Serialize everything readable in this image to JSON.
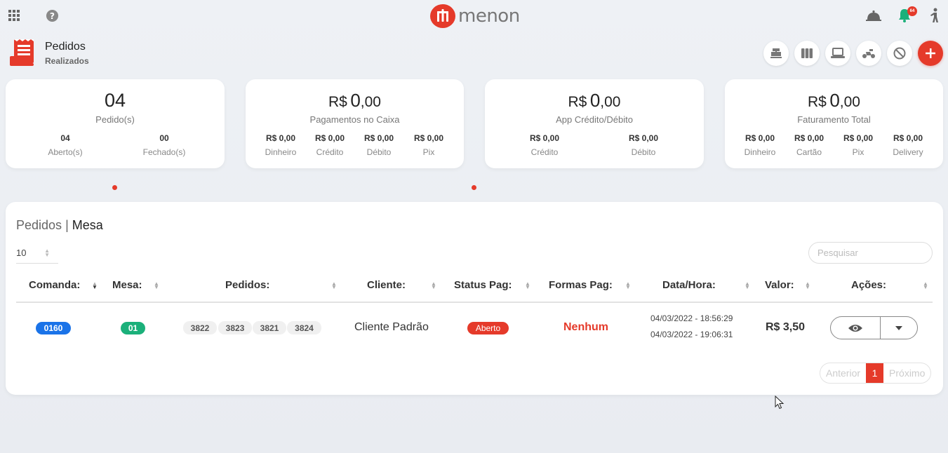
{
  "brand": {
    "name": "menon",
    "color": "#e53a2a"
  },
  "topbar": {
    "left_icons": [
      "apps-grid-icon",
      "help-icon"
    ],
    "right_icons": [
      "cloche-icon",
      "bell-icon",
      "person-icon"
    ],
    "bell_badge": "64"
  },
  "page": {
    "title": "Pedidos",
    "subtitle": "Realizados",
    "icon": "receipt-icon"
  },
  "top_actions": [
    "cash-register-icon",
    "columns-icon",
    "laptop-icon",
    "delivery-icon",
    "block-icon",
    "add-icon"
  ],
  "cards": {
    "orders": {
      "count": "04",
      "caption": "Pedido(s)",
      "items": [
        {
          "value": "04",
          "label": "Aberto(s)"
        },
        {
          "value": "00",
          "label": "Fechado(s)"
        }
      ]
    },
    "cashier": {
      "currency": "R$",
      "int": "0",
      "dec": ",00",
      "caption": "Pagamentos no Caixa",
      "items": [
        {
          "value": "R$ 0,00",
          "label": "Dinheiro"
        },
        {
          "value": "R$ 0,00",
          "label": "Crédito"
        },
        {
          "value": "R$ 0,00",
          "label": "Débito"
        },
        {
          "value": "R$ 0,00",
          "label": "Pix"
        }
      ]
    },
    "app": {
      "currency": "R$",
      "int": "0",
      "dec": ",00",
      "caption": "App Crédito/Débito",
      "items": [
        {
          "value": "R$ 0,00",
          "label": "Crédito"
        },
        {
          "value": "R$ 0,00",
          "label": "Débito"
        }
      ]
    },
    "total": {
      "currency": "R$",
      "int": "0",
      "dec": ",00",
      "caption": "Faturamento Total",
      "items": [
        {
          "value": "R$ 0,00",
          "label": "Dinheiro"
        },
        {
          "value": "R$ 0,00",
          "label": "Cartão"
        },
        {
          "value": "R$ 0,00",
          "label": "Pix"
        },
        {
          "value": "R$ 0,00",
          "label": "Delivery"
        }
      ]
    }
  },
  "table": {
    "title_a": "Pedidos",
    "separator": " | ",
    "title_b": "Mesa",
    "page_length": "10",
    "search_placeholder": "Pesquisar",
    "headers": [
      "Comanda:",
      "Mesa:",
      "Pedidos:",
      "Cliente:",
      "Status Pag:",
      "Formas Pag:",
      "Data/Hora:",
      "Valor:",
      "Ações:"
    ],
    "rows": [
      {
        "comanda": "0160",
        "mesa": "01",
        "pedidos": [
          "3822",
          "3823",
          "3821",
          "3824"
        ],
        "cliente": "Cliente Padrão",
        "status": "Aberto",
        "formas": "Nenhum",
        "data_inicio": "04/03/2022 - 18:56:29",
        "data_fim": "04/03/2022 - 19:06:31",
        "valor": "R$ 3,50"
      }
    ],
    "pagination": {
      "prev": "Anterior",
      "current": "1",
      "next": "Próximo"
    }
  },
  "colors": {
    "blue_pill": "#1a73e8",
    "green_pill": "#1bb07a",
    "red": "#e53a2a"
  }
}
